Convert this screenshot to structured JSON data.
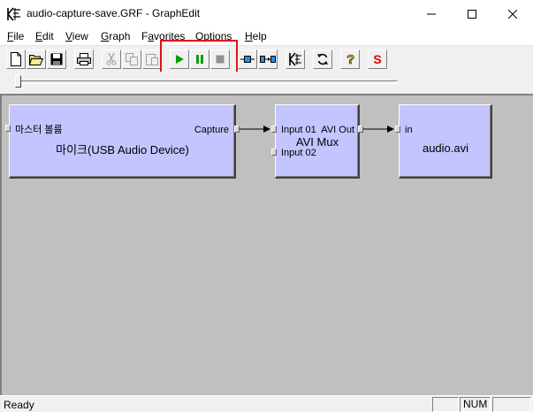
{
  "window": {
    "title": "audio-capture-save.GRF - GraphEdit",
    "app_icon": "graphedit-icon",
    "controls": [
      "minimize-icon",
      "maximize-icon",
      "close-icon"
    ]
  },
  "menu": {
    "items": [
      {
        "label": "File",
        "accel": "F",
        "rest": "ile"
      },
      {
        "label": "Edit",
        "accel": "E",
        "rest": "dit"
      },
      {
        "label": "View",
        "accel": "V",
        "rest": "iew"
      },
      {
        "label": "Graph",
        "accel": "G",
        "rest": "raph"
      },
      {
        "label": "Favorites",
        "accel": "a",
        "pre": "F",
        "rest": "vorites"
      },
      {
        "label": "Options",
        "accel": "O",
        "rest": "ptions"
      },
      {
        "label": "Help",
        "accel": "H",
        "rest": "elp"
      }
    ]
  },
  "toolbar": {
    "buttons": [
      {
        "icon": "new-icon"
      },
      {
        "icon": "open-icon"
      },
      {
        "icon": "save-icon"
      },
      {
        "icon": "print-icon"
      },
      {
        "icon": "cut-icon",
        "disabled": true
      },
      {
        "icon": "copy-icon",
        "disabled": true
      },
      {
        "icon": "paste-icon",
        "disabled": true
      },
      {
        "icon": "play-icon"
      },
      {
        "icon": "pause-icon"
      },
      {
        "icon": "stop-icon"
      },
      {
        "icon": "seek-icon"
      },
      {
        "icon": "connect-icon"
      },
      {
        "icon": "render-icon"
      },
      {
        "icon": "refresh-icon"
      },
      {
        "icon": "help-icon"
      },
      {
        "icon": "sync-source-icon",
        "glyph": "S"
      }
    ],
    "highlight_color": "#e0101a"
  },
  "graph": {
    "filters": [
      {
        "id": "audio-device",
        "top_label": "마스터 볼륨",
        "title": "마이크(USB Audio Device)",
        "input_pins": [],
        "output_pins": [
          {
            "label": "Capture"
          }
        ]
      },
      {
        "id": "avi-mux",
        "title": "AVI Mux",
        "input_pins": [
          {
            "label": "Input 01"
          },
          {
            "label": "Input 02"
          }
        ],
        "output_pins": [
          {
            "label": "AVI Out"
          }
        ]
      },
      {
        "id": "file-writer",
        "title": "audio.avi",
        "input_pins": [
          {
            "label": "in"
          }
        ],
        "output_pins": []
      }
    ],
    "colors": {
      "filter_fill": "#c4c4ff",
      "canvas": "#c0c0c0"
    }
  },
  "status": {
    "text": "Ready",
    "panes": [
      "",
      "NUM",
      ""
    ]
  }
}
